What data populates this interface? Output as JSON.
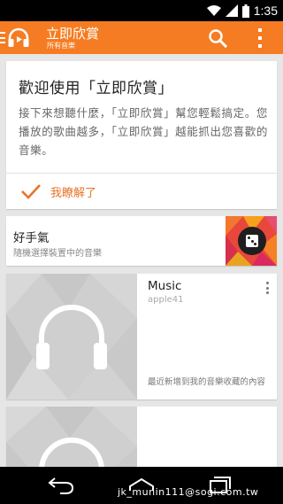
{
  "status_bar": {
    "time": "1:35",
    "icons": [
      "wifi-icon",
      "signal-icon",
      "battery-icon"
    ]
  },
  "app_bar": {
    "title": "立即欣賞",
    "subtitle": "所有音樂",
    "icons": [
      "menu-icon",
      "headphones-logo-icon",
      "search-icon",
      "overflow-icon"
    ],
    "color": "#f57c22"
  },
  "welcome_card": {
    "title": "歡迎使用「立即欣賞」",
    "body": "接下來想聽什麼，「立即欣賞」幫您輕鬆搞定。您播放的歌曲越多，「立即欣賞」越能抓出您喜歡的音樂。",
    "action_label": "我瞭解了",
    "action_icon": "check-icon",
    "accent": "#e7742a"
  },
  "lucky_card": {
    "title": "好手氣",
    "subtitle": "隨機選擇裝置中的音樂",
    "icon": "dice-icon"
  },
  "music_card": {
    "title": "Music",
    "artist": "apple41",
    "description": "最近新增到我的音樂收藏的內容",
    "art_icon": "headphones-icon"
  },
  "nav_bar": {
    "icons": [
      "back-icon",
      "home-icon",
      "recents-icon"
    ]
  },
  "watermark": "jk_munin111@sogi.com.tw"
}
